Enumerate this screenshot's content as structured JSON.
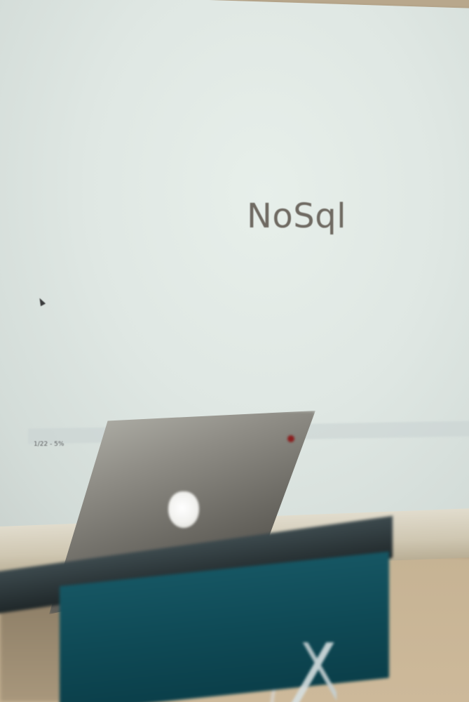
{
  "slide": {
    "title": "NoSql"
  },
  "presentation_status": {
    "text": "1/22 - 5%"
  },
  "laptop": {
    "logo_icon": "apple-logo-icon"
  },
  "colors": {
    "screen": "#dfe7e3",
    "slide_text": "#6f6a62",
    "podium_cloth": "#0f4a56",
    "wall": "#c6b394"
  }
}
